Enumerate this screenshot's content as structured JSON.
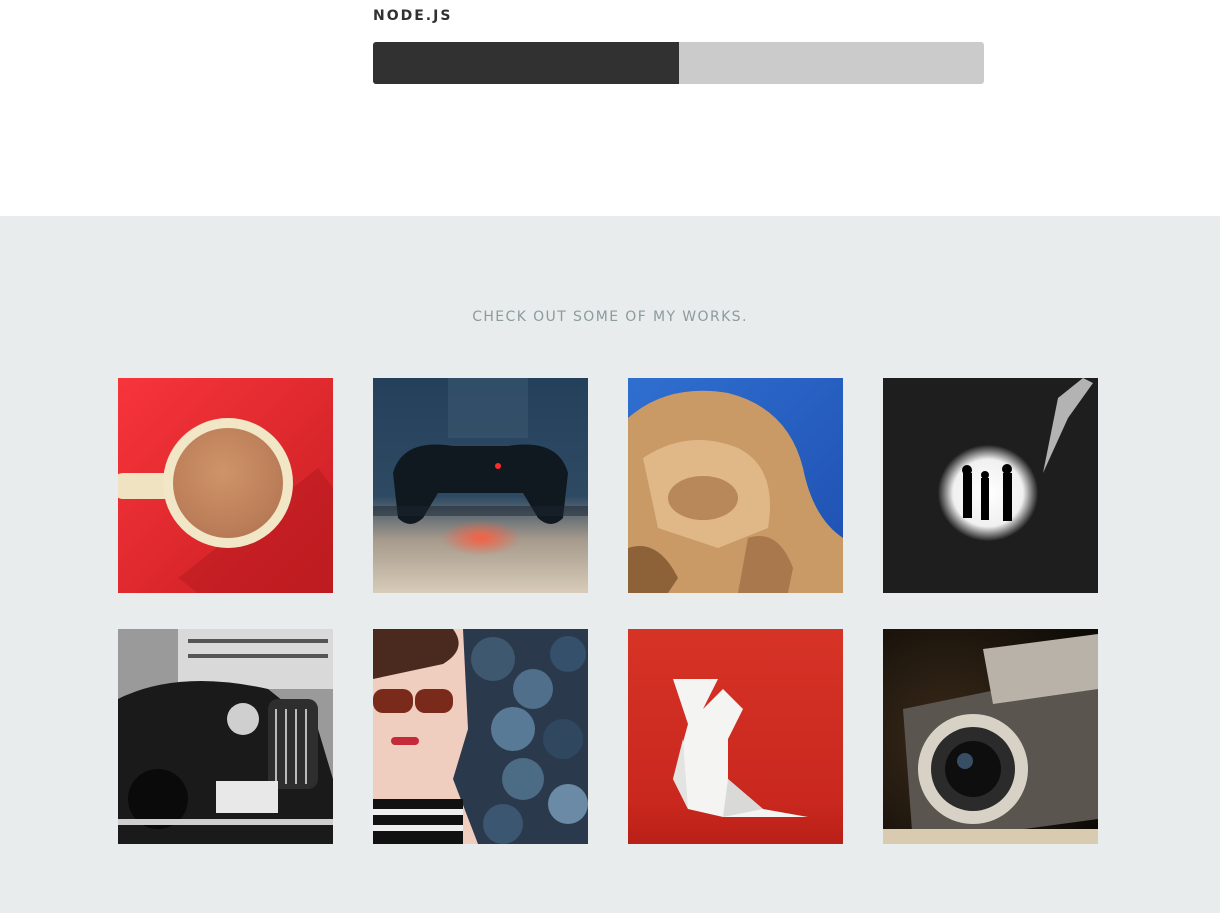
{
  "skill": {
    "name": "NODE.JS",
    "progress_percent": 50,
    "colors": {
      "fill": "#313131",
      "track": "#cbcbcb"
    }
  },
  "works": {
    "heading": "CHECK OUT SOME OF MY WORKS.",
    "background": "#e8ecec",
    "items": [
      {
        "name": "coffee-cup-image"
      },
      {
        "name": "game-controller-image"
      },
      {
        "name": "lion-statue-image"
      },
      {
        "name": "tunnel-silhouettes-image"
      },
      {
        "name": "vintage-car-image"
      },
      {
        "name": "woman-sunglasses-image"
      },
      {
        "name": "origami-bird-image"
      },
      {
        "name": "retro-camera-image"
      }
    ]
  }
}
